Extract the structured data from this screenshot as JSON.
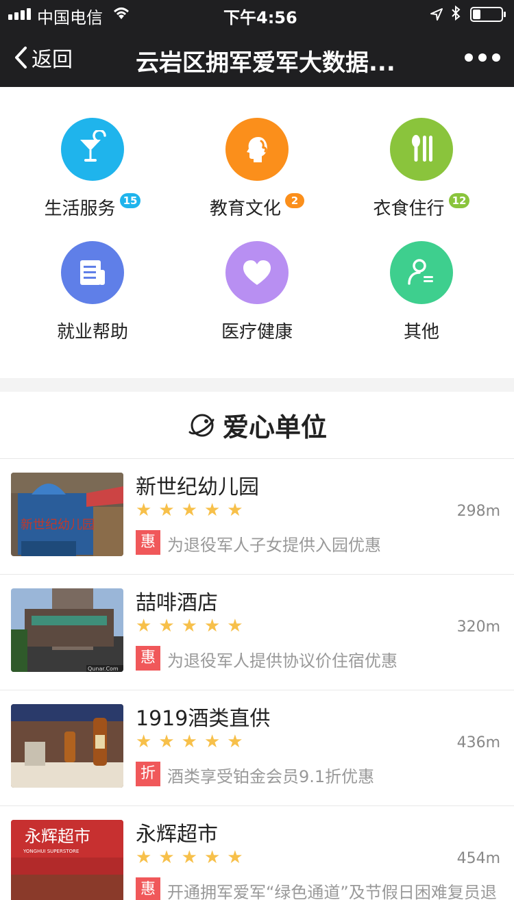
{
  "status": {
    "carrier": "中国电信",
    "time": "下午4:56"
  },
  "nav": {
    "back_label": "返回",
    "title": "云岩区拥军爱军大数据..."
  },
  "categories": [
    {
      "label": "生活服务",
      "badge": "15",
      "icon": "cocktail-icon",
      "color": "#1fb4ec",
      "badge_color": "#1fb4ec"
    },
    {
      "label": "教育文化",
      "badge": "2",
      "icon": "person-profile-icon",
      "color": "#fb8f1b",
      "badge_color": "#fb8f1b"
    },
    {
      "label": "衣食住行",
      "badge": "12",
      "icon": "utensils-icon",
      "color": "#8ac43c",
      "badge_color": "#8ac43c"
    },
    {
      "label": "就业帮助",
      "badge": "",
      "icon": "document-icon",
      "color": "#5f7fe8"
    },
    {
      "label": "医疗健康",
      "badge": "",
      "icon": "heart-icon",
      "color": "#b88ff2"
    },
    {
      "label": "其他",
      "badge": "",
      "icon": "user-list-icon",
      "color": "#3ecf8e"
    }
  ],
  "section": {
    "title": "爱心单位",
    "icon": "planet-icon"
  },
  "stars": "★",
  "units": [
    {
      "name": "新世纪幼儿园",
      "rating": 5,
      "distance": "298m",
      "tag": "惠",
      "desc": "为退役军人子女提供入园优惠"
    },
    {
      "name": "喆啡酒店",
      "rating": 5,
      "distance": "320m",
      "tag": "惠",
      "desc": "为退役军人提供协议价住宿优惠"
    },
    {
      "name": "1919酒类直供",
      "rating": 5,
      "distance": "436m",
      "tag": "折",
      "desc": "酒类享受铂金会员9.1折优惠"
    },
    {
      "name": "永辉超市",
      "rating": 5,
      "distance": "454m",
      "tag": "惠",
      "desc": "开通拥军爱军“绿色通道”及节假日困难复员退"
    }
  ],
  "thumbs": [
    {
      "text": "新世纪幼儿园"
    },
    {
      "text": "Qunar.Com"
    },
    {
      "text": ""
    },
    {
      "text": "永辉超市",
      "sub": "YONGHUI SUPERSTORE"
    }
  ]
}
